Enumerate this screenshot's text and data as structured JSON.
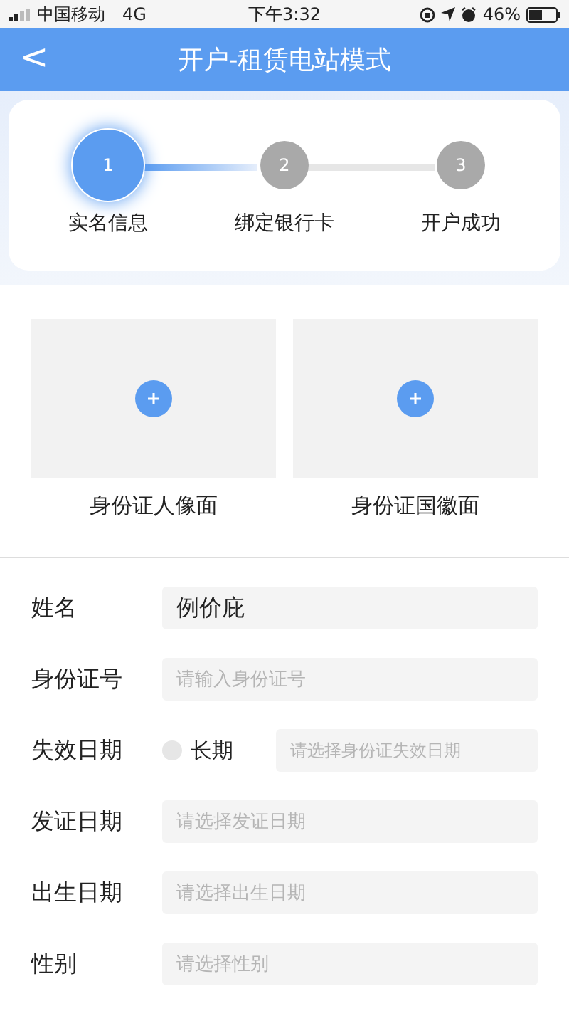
{
  "status_bar": {
    "carrier": "中国移动",
    "network": "4G",
    "time": "下午3:32",
    "battery": "46%"
  },
  "nav": {
    "back": "<",
    "title": "开户-租赁电站模式"
  },
  "steps": [
    {
      "number": "1",
      "label": "实名信息",
      "selected": true
    },
    {
      "number": "2",
      "label": "绑定银行卡",
      "selected": false
    },
    {
      "number": "3",
      "label": "开户成功",
      "selected": false
    }
  ],
  "uploads": [
    {
      "label": "身份证人像面"
    },
    {
      "label": "身份证国徽面"
    }
  ],
  "fields": [
    {
      "kind": "text",
      "label": "姓名",
      "value": "例价庇"
    },
    {
      "kind": "text",
      "label": "身份证号",
      "placeholder": "请输入身份证号"
    },
    {
      "kind": "expiry",
      "label": "失效日期",
      "checkbox": {
        "label": "长期",
        "checked": false
      },
      "placeholder": "请选择身份证失效日期"
    },
    {
      "kind": "text",
      "label": "发证日期",
      "placeholder": "请选择发证日期"
    },
    {
      "kind": "text",
      "label": "出生日期",
      "placeholder": "请选择出生日期"
    },
    {
      "kind": "text",
      "label": "性别",
      "placeholder": "请选择性别"
    }
  ]
}
